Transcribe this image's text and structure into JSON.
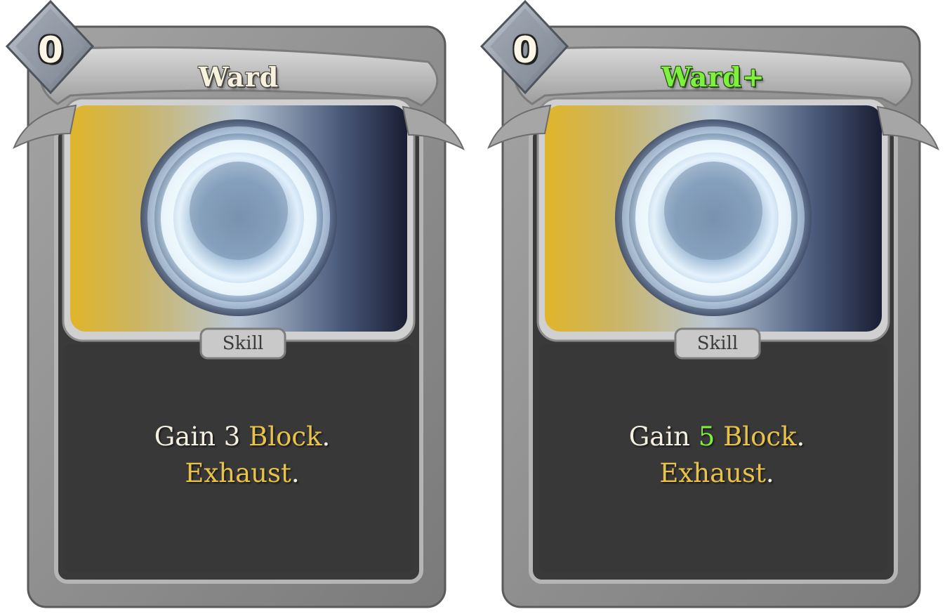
{
  "cards": [
    {
      "cost": "0",
      "name": "Ward",
      "type": "Skill",
      "desc_line1": {
        "w1": "Gain",
        "num": "3",
        "kw1": "Block",
        "p1": "."
      },
      "desc_line2": {
        "kw2": "Exhaust",
        "p2": "."
      }
    },
    {
      "cost": "0",
      "name": "Ward+",
      "type": "Skill",
      "desc_line1": {
        "w1": "Gain",
        "num": "5",
        "kw1": "Block",
        "p1": "."
      },
      "desc_line2": {
        "kw2": "Exhaust",
        "p2": "."
      }
    }
  ],
  "colors": {
    "frame": "#8e8e8e",
    "frame_dark": "#5f5f5f",
    "panel": "#3a3a3a",
    "keyword": "#e9c24a",
    "upgrade": "#7cf23c",
    "text": "#f4efe0"
  },
  "icons": {
    "cost_gem": "diamond-gem-icon",
    "art": "ward-sphere-art"
  }
}
